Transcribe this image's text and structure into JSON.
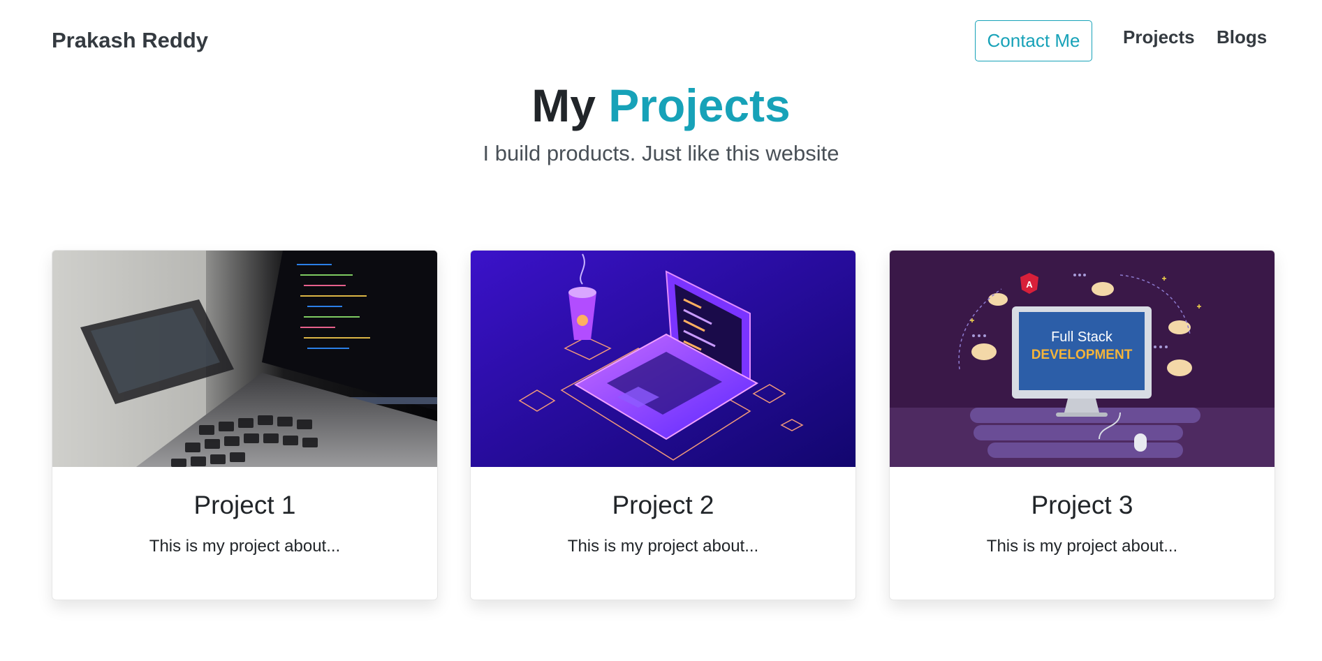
{
  "nav": {
    "brand": "Prakash Reddy",
    "contact_label": "Contact Me",
    "links": [
      "Projects",
      "Blogs"
    ]
  },
  "hero": {
    "title_part1": "My ",
    "title_part2": "Projects",
    "subtitle": "I build products. Just like this website"
  },
  "projects": [
    {
      "title": "Project 1",
      "description": "This is my project about...",
      "image": "laptop-code-photo"
    },
    {
      "title": "Project 2",
      "description": "This is my project about...",
      "image": "isometric-laptop-illustration"
    },
    {
      "title": "Project 3",
      "description": "This is my project about...",
      "image": "full-stack-development-illustration",
      "image_text": {
        "line1": "Full Stack",
        "line2": "DEVELOPMENT"
      }
    }
  ],
  "colors": {
    "accent": "#17a2b8",
    "dark": "#343a40",
    "p2_bg": "#2a0fb5",
    "p3_bg": "#3a1848"
  }
}
